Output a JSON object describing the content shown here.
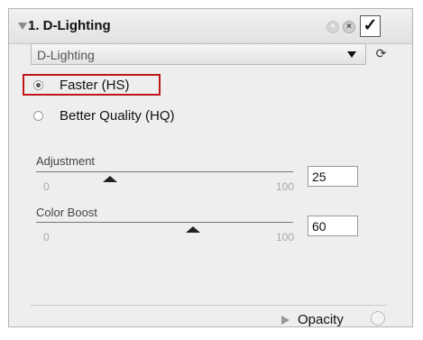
{
  "header": {
    "title": "1. D-Lighting",
    "checked": true
  },
  "method_dropdown": {
    "selected": "D-Lighting"
  },
  "options": {
    "faster": {
      "label": "Faster (HS)",
      "selected": true
    },
    "better": {
      "label": "Better Quality (HQ)",
      "selected": false
    }
  },
  "adjustment": {
    "label": "Adjustment",
    "min": "0",
    "max": "100",
    "value": "25"
  },
  "color_boost": {
    "label": "Color Boost",
    "min": "0",
    "max": "100",
    "value": "60"
  },
  "opacity": {
    "label": "Opacity"
  },
  "colors": {
    "highlight": "#c0161c"
  },
  "icons": {
    "collapse": "triangle-down-icon",
    "reset": "reset-icon",
    "delete": "close-icon",
    "enable": "checkmark-icon",
    "apply": "apply-icon",
    "expand": "triangle-right-icon"
  }
}
